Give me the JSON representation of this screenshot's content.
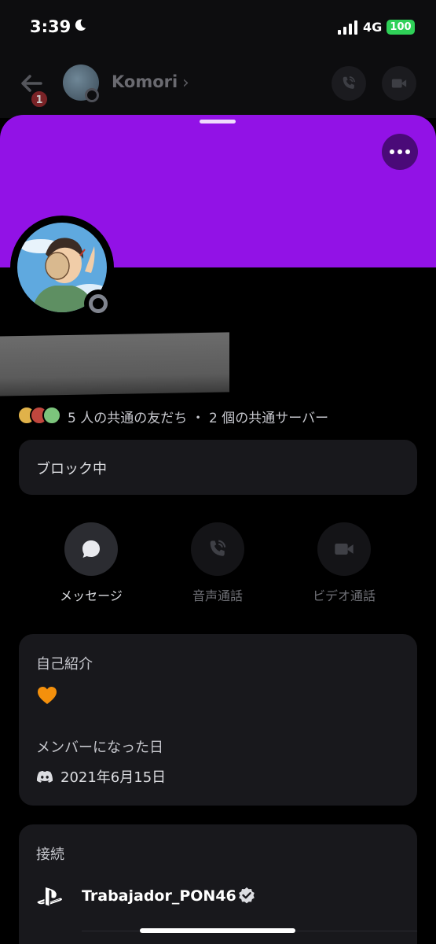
{
  "status_bar": {
    "time": "3:39",
    "network": "4G",
    "battery": "100"
  },
  "header": {
    "back_badge": "1",
    "contact_name": "Komori"
  },
  "profile": {
    "mutual_text": "5 人の共通の友だち ・ 2 個の共通サーバー",
    "blocked_label": "ブロック中"
  },
  "actions": [
    {
      "label": "メッセージ",
      "icon": "message-icon"
    },
    {
      "label": "音声通話",
      "icon": "phone-call-icon"
    },
    {
      "label": "ビデオ通話",
      "icon": "video-icon"
    }
  ],
  "about": {
    "title": "自己紹介",
    "bio_emoji": "orange-heart-icon",
    "member_since_title": "メンバーになった日",
    "member_since_date": "2021年6月15日"
  },
  "connections": {
    "title": "接続",
    "items": [
      {
        "service_icon": "playstation-icon",
        "name": "Trabajador_PON46",
        "verified": true
      }
    ]
  },
  "colors": {
    "banner": "#9212e6",
    "card_bg": "#18181c",
    "battery": "#2fd158"
  }
}
